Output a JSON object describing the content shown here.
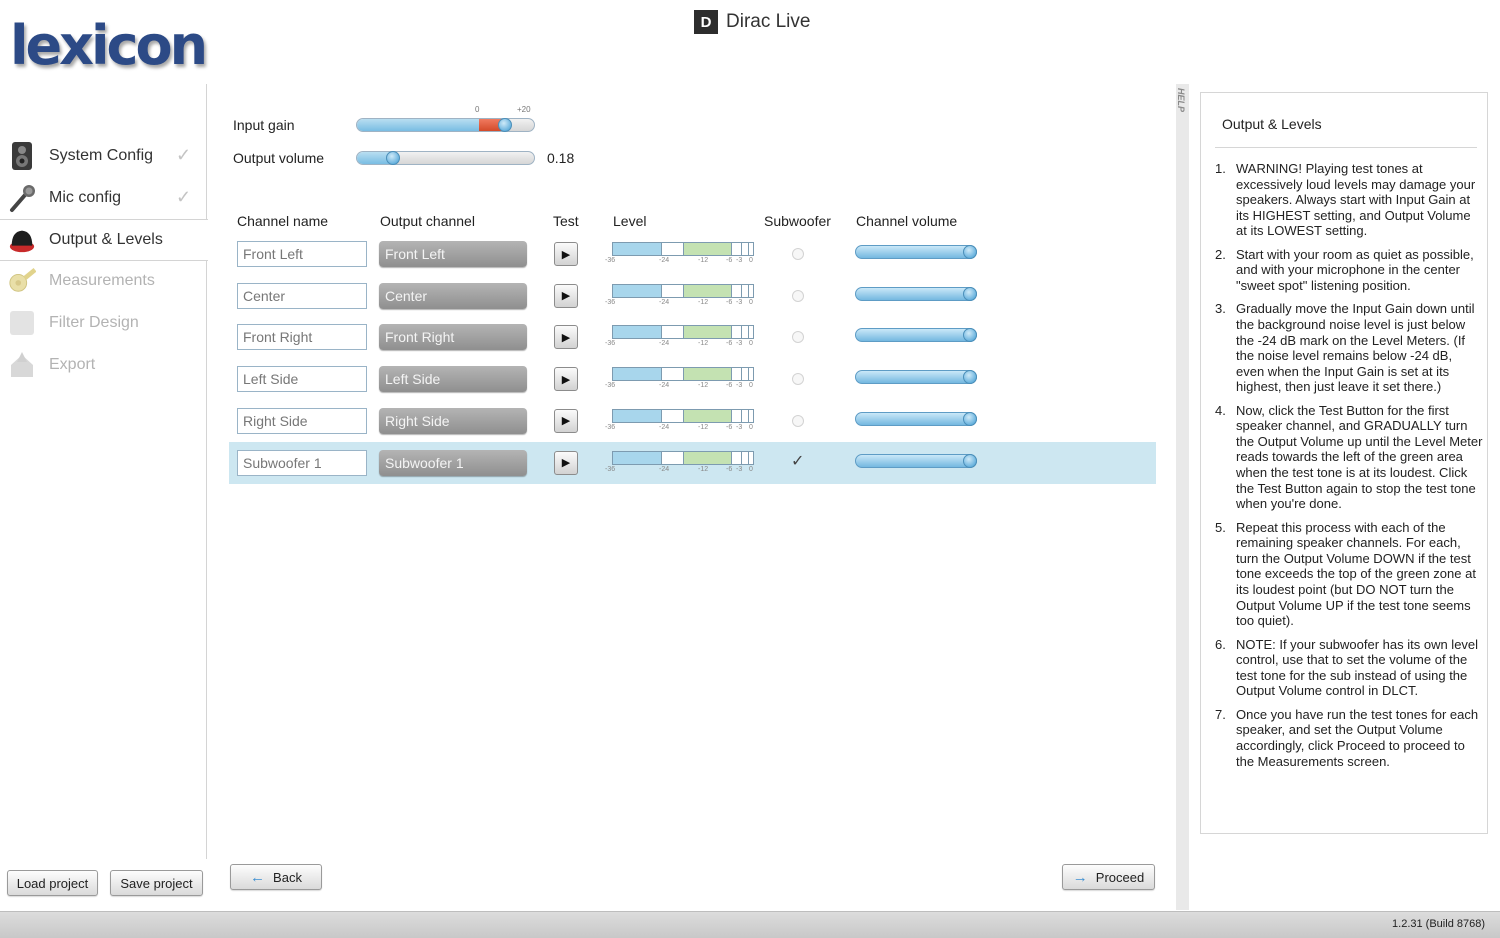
{
  "app": {
    "logo_text": "lexicon",
    "title_badge": "D",
    "title": "Dirac Live",
    "version": "1.2.31 (Build 8768)"
  },
  "sidebar": {
    "items": [
      {
        "label": "System Config",
        "state": "done",
        "icon": "speaker-icon"
      },
      {
        "label": "Mic config",
        "state": "done",
        "icon": "microphone-icon"
      },
      {
        "label": "Output & Levels",
        "state": "active",
        "icon": "speaker-cap-icon"
      },
      {
        "label": "Measurements",
        "state": "disabled",
        "icon": "measuring-tape-icon"
      },
      {
        "label": "Filter Design",
        "state": "disabled",
        "icon": "filter-icon"
      },
      {
        "label": "Export",
        "state": "disabled",
        "icon": "export-icon"
      }
    ],
    "load_label": "Load project",
    "save_label": "Save project"
  },
  "gain": {
    "input_label": "Input gain",
    "input_tick_min": "0",
    "input_tick_max": "+20",
    "output_label": "Output volume",
    "output_value": "0.18"
  },
  "table": {
    "headers": {
      "name": "Channel name",
      "output": "Output channel",
      "test": "Test",
      "level": "Level",
      "subwoofer": "Subwoofer",
      "volume": "Channel volume"
    },
    "meter_scale": [
      "-36",
      "-24",
      "-12",
      "-6",
      "-3",
      "0"
    ],
    "play_glyph": "▶",
    "check_glyph": "✓",
    "rows": [
      {
        "name": "Front Left",
        "output": "Front Left",
        "subwoofer": false,
        "selected": false
      },
      {
        "name": "Center",
        "output": "Center",
        "subwoofer": false,
        "selected": false
      },
      {
        "name": "Front Right",
        "output": "Front Right",
        "subwoofer": false,
        "selected": false
      },
      {
        "name": "Left Side",
        "output": "Left Side",
        "subwoofer": false,
        "selected": false
      },
      {
        "name": "Right Side",
        "output": "Right Side",
        "subwoofer": false,
        "selected": false
      },
      {
        "name": "Subwoofer 1",
        "output": "Subwoofer 1",
        "subwoofer": true,
        "selected": true
      }
    ]
  },
  "nav": {
    "back_label": "Back",
    "proceed_label": "Proceed"
  },
  "help": {
    "strip_label": "HELP",
    "title": "Output & Levels",
    "items": [
      "WARNING! Playing test tones at excessively loud levels may damage your speakers. Always start with Input Gain at its HIGHEST setting, and Output Volume at its LOWEST setting.",
      "Start with your room as quiet as possible, and with your microphone in the center \"sweet spot\" listening position.",
      "Gradually move the Input Gain down until the background noise level is just below the -24 dB mark on the Level Meters. (If the noise level remains below -24 dB, even when the Input Gain is set at its highest, then just leave it set there.)",
      "Now, click the Test Button for the first speaker channel, and GRADUALLY turn the Output Volume up until the Level Meter reads towards the left of the green area when the test tone is at its loudest. Click the Test Button again to stop the test tone when you're done.",
      "Repeat this process with each of the remaining speaker channels. For each, turn the Output Volume DOWN if the test tone exceeds the top of the green zone at its loudest point (but DO NOT turn the Output Volume UP if the test tone seems too quiet).",
      "NOTE: If your subwoofer has its own level control, use that to set the volume of the test tone for the sub instead of using the Output Volume control in DLCT.",
      "Once you have run the test tones for each speaker, and set the Output Volume accordingly, click Proceed to proceed to the Measurements screen."
    ]
  },
  "colors": {
    "accent": "#3d8fd1",
    "selected_row": "#cde7f1",
    "logo": "#2c4a86"
  }
}
